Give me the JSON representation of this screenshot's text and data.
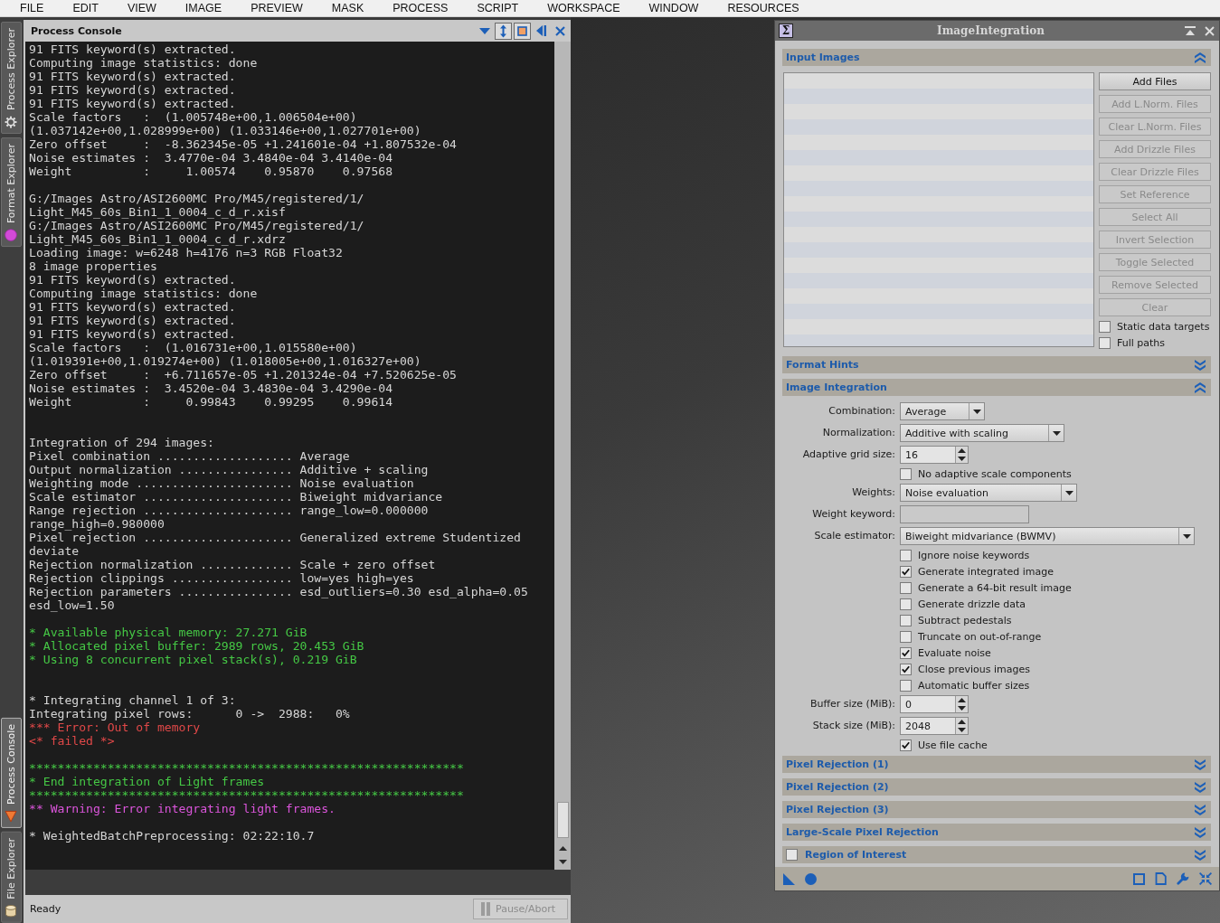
{
  "menu_bar": {
    "items": [
      "FILE",
      "EDIT",
      "VIEW",
      "IMAGE",
      "PREVIEW",
      "MASK",
      "PROCESS",
      "SCRIPT",
      "WORKSPACE",
      "WINDOW",
      "RESOURCES"
    ]
  },
  "left_dock": {
    "top_tabs": [
      {
        "label": "Process Explorer",
        "selected": false
      },
      {
        "label": "Format Explorer",
        "selected": false
      }
    ],
    "bottom_tabs": [
      {
        "label": "Process Console",
        "selected": true
      },
      {
        "label": "File Explorer",
        "selected": false
      }
    ]
  },
  "process_console": {
    "title": "Process Console",
    "lines": [
      {
        "kind": "normal",
        "text": "91 FITS keyword(s) extracted."
      },
      {
        "kind": "normal",
        "text": "Computing image statistics: done"
      },
      {
        "kind": "normal",
        "text": "91 FITS keyword(s) extracted."
      },
      {
        "kind": "normal",
        "text": "91 FITS keyword(s) extracted."
      },
      {
        "kind": "normal",
        "text": "91 FITS keyword(s) extracted."
      },
      {
        "kind": "normal",
        "text": "Scale factors   :  (1.005748e+00,1.006504e+00)"
      },
      {
        "kind": "normal",
        "text": "(1.037142e+00,1.028999e+00) (1.033146e+00,1.027701e+00)"
      },
      {
        "kind": "normal",
        "text": "Zero offset     :  -8.362345e-05 +1.241601e-04 +1.807532e-04"
      },
      {
        "kind": "normal",
        "text": "Noise estimates :  3.4770e-04 3.4840e-04 3.4140e-04"
      },
      {
        "kind": "normal",
        "text": "Weight          :     1.00574    0.95870    0.97568"
      },
      {
        "kind": "blank"
      },
      {
        "kind": "normal",
        "text": "G:/Images Astro/ASI2600MC Pro/M45/registered/1/"
      },
      {
        "kind": "normal",
        "text": "Light_M45_60s_Bin1_1_0004_c_d_r.xisf"
      },
      {
        "kind": "normal",
        "text": "G:/Images Astro/ASI2600MC Pro/M45/registered/1/"
      },
      {
        "kind": "normal",
        "text": "Light_M45_60s_Bin1_1_0004_c_d_r.xdrz"
      },
      {
        "kind": "normal",
        "text": "Loading image: w=6248 h=4176 n=3 RGB Float32"
      },
      {
        "kind": "normal",
        "text": "8 image properties"
      },
      {
        "kind": "normal",
        "text": "91 FITS keyword(s) extracted."
      },
      {
        "kind": "normal",
        "text": "Computing image statistics: done"
      },
      {
        "kind": "normal",
        "text": "91 FITS keyword(s) extracted."
      },
      {
        "kind": "normal",
        "text": "91 FITS keyword(s) extracted."
      },
      {
        "kind": "normal",
        "text": "91 FITS keyword(s) extracted."
      },
      {
        "kind": "normal",
        "text": "Scale factors   :  (1.016731e+00,1.015580e+00)"
      },
      {
        "kind": "normal",
        "text": "(1.019391e+00,1.019274e+00) (1.018005e+00,1.016327e+00)"
      },
      {
        "kind": "normal",
        "text": "Zero offset     :  +6.711657e-05 +1.201324e-04 +7.520625e-05"
      },
      {
        "kind": "normal",
        "text": "Noise estimates :  3.4520e-04 3.4830e-04 3.4290e-04"
      },
      {
        "kind": "normal",
        "text": "Weight          :     0.99843    0.99295    0.99614"
      },
      {
        "kind": "blank"
      },
      {
        "kind": "blank"
      },
      {
        "kind": "normal",
        "text": "Integration of 294 images:"
      },
      {
        "kind": "normal",
        "text": "Pixel combination ................... Average"
      },
      {
        "kind": "normal",
        "text": "Output normalization ................ Additive + scaling"
      },
      {
        "kind": "normal",
        "text": "Weighting mode ...................... Noise evaluation"
      },
      {
        "kind": "normal",
        "text": "Scale estimator ..................... Biweight midvariance"
      },
      {
        "kind": "normal",
        "text": "Range rejection ..................... range_low=0.000000"
      },
      {
        "kind": "normal",
        "text": "range_high=0.980000"
      },
      {
        "kind": "normal",
        "text": "Pixel rejection ..................... Generalized extreme Studentized"
      },
      {
        "kind": "normal",
        "text": "deviate"
      },
      {
        "kind": "normal",
        "text": "Rejection normalization ............. Scale + zero offset"
      },
      {
        "kind": "normal",
        "text": "Rejection clippings ................. low=yes high=yes"
      },
      {
        "kind": "normal",
        "text": "Rejection parameters ................ esd_outliers=0.30 esd_alpha=0.05"
      },
      {
        "kind": "normal",
        "text": "esd_low=1.50"
      },
      {
        "kind": "blank"
      },
      {
        "kind": "success",
        "text": "* Available physical memory: 27.271 GiB"
      },
      {
        "kind": "success",
        "text": "* Allocated pixel buffer: 2989 rows, 20.453 GiB"
      },
      {
        "kind": "success",
        "text": "* Using 8 concurrent pixel stack(s), 0.219 GiB"
      },
      {
        "kind": "blank"
      },
      {
        "kind": "blank"
      },
      {
        "kind": "normal",
        "text": "* Integrating channel 1 of 3:"
      },
      {
        "kind": "normal",
        "text": "Integrating pixel rows:      0 ->  2988:   0%"
      },
      {
        "kind": "error",
        "text": "*** Error: Out of memory"
      },
      {
        "kind": "error",
        "text": "<* failed *>"
      },
      {
        "kind": "blank"
      },
      {
        "kind": "success",
        "text": "*************************************************************"
      },
      {
        "kind": "success",
        "text": "* End integration of Light frames"
      },
      {
        "kind": "success",
        "text": "*************************************************************"
      },
      {
        "kind": "warning",
        "text": "** Warning: Error integrating light frames."
      },
      {
        "kind": "blank"
      },
      {
        "kind": "normal",
        "text": "* WeightedBatchPreprocessing: 02:22:10.7"
      }
    ],
    "status": "Ready",
    "pause_button": {
      "label": "Pause/Abort",
      "disabled": true
    }
  },
  "image_integration": {
    "icon": "Σ",
    "title": "ImageIntegration",
    "sections": [
      {
        "title": "Input Images",
        "expanded": true,
        "buttons": [
          {
            "label": "Add Files",
            "disabled": false
          },
          {
            "label": "Add L.Norm. Files",
            "disabled": true
          },
          {
            "label": "Clear L.Norm. Files",
            "disabled": true
          },
          {
            "label": "Add Drizzle Files",
            "disabled": true
          },
          {
            "label": "Clear Drizzle Files",
            "disabled": true
          },
          {
            "label": "Set Reference",
            "disabled": true
          },
          {
            "label": "Select All",
            "disabled": true
          },
          {
            "label": "Invert Selection",
            "disabled": true
          },
          {
            "label": "Toggle Selected",
            "disabled": true
          },
          {
            "label": "Remove Selected",
            "disabled": true
          },
          {
            "label": "Clear",
            "disabled": true
          }
        ],
        "options": [
          {
            "label": "Static data targets",
            "checked": false
          },
          {
            "label": "Full paths",
            "checked": false
          }
        ]
      },
      {
        "title": "Format Hints",
        "expanded": false
      },
      {
        "title": "Image Integration",
        "expanded": true,
        "fields": [
          {
            "kind": "combo",
            "label": "Combination:",
            "value": "Average"
          },
          {
            "kind": "combo",
            "label": "Normalization:",
            "value": "Additive with scaling"
          },
          {
            "kind": "spin",
            "label": "Adaptive grid size:",
            "value": "16"
          },
          {
            "kind": "check",
            "label": "No adaptive scale components",
            "checked": false
          },
          {
            "kind": "combo",
            "label": "Weights:",
            "value": "Noise evaluation"
          },
          {
            "kind": "text",
            "label": "Weight keyword:"
          },
          {
            "kind": "combo",
            "label": "Scale estimator:",
            "value": "Biweight midvariance (BWMV)"
          },
          {
            "kind": "check",
            "label": "Ignore noise keywords",
            "checked": false
          },
          {
            "kind": "check",
            "label": "Generate integrated image",
            "checked": true
          },
          {
            "kind": "check",
            "label": "Generate a 64-bit result image",
            "checked": false
          },
          {
            "kind": "check",
            "label": "Generate drizzle data",
            "checked": false
          },
          {
            "kind": "check",
            "label": "Subtract pedestals",
            "checked": false
          },
          {
            "kind": "check",
            "label": "Truncate on out-of-range",
            "checked": false
          },
          {
            "kind": "check",
            "label": "Evaluate noise",
            "checked": true
          },
          {
            "kind": "check",
            "label": "Close previous images",
            "checked": true
          },
          {
            "kind": "check",
            "label": "Automatic buffer sizes",
            "checked": false
          },
          {
            "kind": "spin",
            "label": "Buffer size (MiB):",
            "value": "0"
          },
          {
            "kind": "spin",
            "label": "Stack size (MiB):",
            "value": "2048"
          },
          {
            "kind": "check",
            "label": "Use file cache",
            "checked": true
          }
        ]
      },
      {
        "title": "Pixel Rejection (1)",
        "expanded": false
      },
      {
        "title": "Pixel Rejection (2)",
        "expanded": false
      },
      {
        "title": "Pixel Rejection (3)",
        "expanded": false
      },
      {
        "title": "Large-Scale Pixel Rejection",
        "expanded": false
      },
      {
        "title": "Region of Interest",
        "expanded": false,
        "checked": false
      }
    ]
  }
}
